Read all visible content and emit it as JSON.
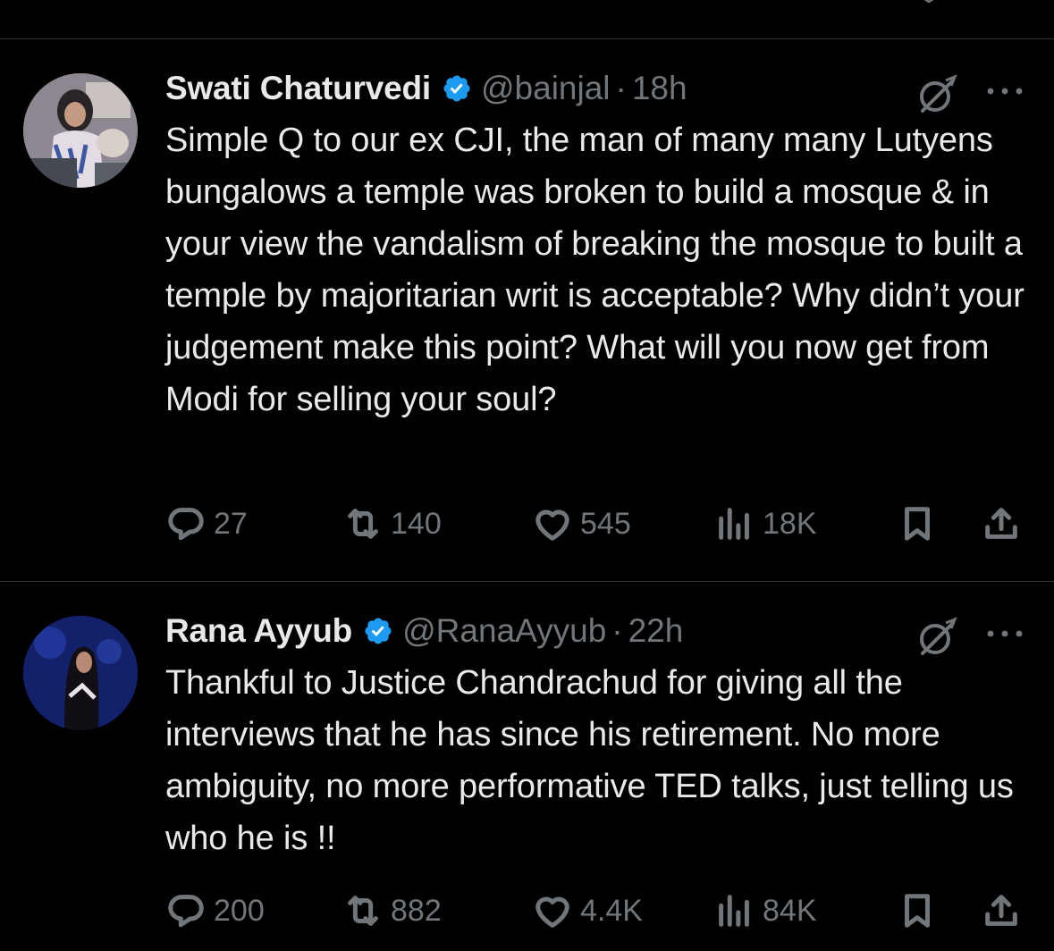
{
  "tweets": [
    {
      "name": "Swati Chaturvedi",
      "handle": "@bainjal",
      "separator": "·",
      "time": "18h",
      "text": "Simple Q to our ex CJI, the man of many many Lutyens bungalows a temple was broken to build a mosque & in your view the vandalism of breaking the mosque to built a temple by majoritarian writ is acceptable? Why didn’t your judgement make this point? What will you now get from Modi for selling your soul?",
      "replies": "27",
      "reposts": "140",
      "likes": "545",
      "views": "18K"
    },
    {
      "name": "Rana Ayyub",
      "handle": "@RanaAyyub",
      "separator": "·",
      "time": "22h",
      "text": "Thankful to Justice Chandrachud for giving all the interviews that he has since his retirement. No more ambiguity, no more performative TED talks, just telling us who he is !!",
      "replies": "200",
      "reposts": "882",
      "likes": "4.4K",
      "views": "84K"
    }
  ],
  "icons": {
    "verified": "verified-badge-icon",
    "grok": "grok-icon",
    "more": "more-options-icon",
    "reply": "reply-icon",
    "repost": "repost-icon",
    "like": "heart-icon",
    "views": "views-icon",
    "bookmark": "bookmark-icon",
    "share": "share-icon"
  },
  "colors": {
    "background": "#000000",
    "text": "#e7e9ea",
    "secondary": "#71767b",
    "verified": "#1d9bf0",
    "divider": "#2f3336"
  }
}
